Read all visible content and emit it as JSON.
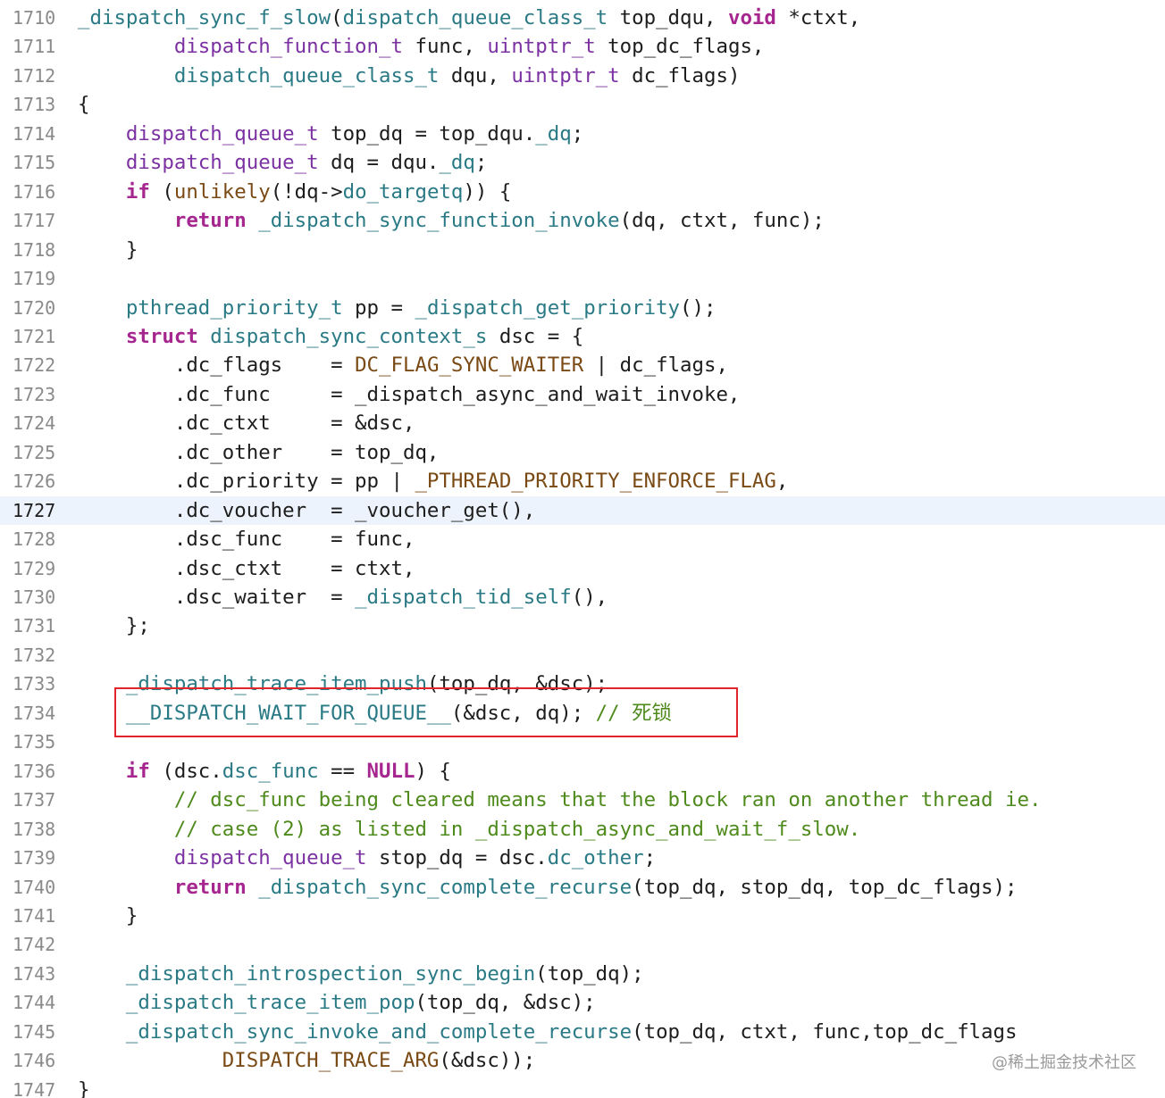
{
  "editor": {
    "current_line": "1727",
    "highlight_line": "1734",
    "watermark": "@稀土掘金技术社区",
    "lines": [
      {
        "num": "1710",
        "tokens": [
          {
            "t": "_dispatch_sync_f_slow",
            "c": "func"
          },
          {
            "t": "(",
            "c": "plain"
          },
          {
            "t": "dispatch_queue_class_t",
            "c": "func"
          },
          {
            "t": " top_dqu, ",
            "c": "plain"
          },
          {
            "t": "void",
            "c": "kw"
          },
          {
            "t": " *ctxt,",
            "c": "plain"
          }
        ]
      },
      {
        "num": "1711",
        "tokens": [
          {
            "t": "        ",
            "c": "plain"
          },
          {
            "t": "dispatch_function_t",
            "c": "type"
          },
          {
            "t": " func, ",
            "c": "plain"
          },
          {
            "t": "uintptr_t",
            "c": "type"
          },
          {
            "t": " top_dc_flags,",
            "c": "plain"
          }
        ]
      },
      {
        "num": "1712",
        "tokens": [
          {
            "t": "        ",
            "c": "plain"
          },
          {
            "t": "dispatch_queue_class_t",
            "c": "func"
          },
          {
            "t": " dqu, ",
            "c": "plain"
          },
          {
            "t": "uintptr_t",
            "c": "type"
          },
          {
            "t": " dc_flags)",
            "c": "plain"
          }
        ]
      },
      {
        "num": "1713",
        "tokens": [
          {
            "t": "{",
            "c": "plain"
          }
        ]
      },
      {
        "num": "1714",
        "tokens": [
          {
            "t": "    ",
            "c": "plain"
          },
          {
            "t": "dispatch_queue_t",
            "c": "type"
          },
          {
            "t": " top_dq = top_dqu.",
            "c": "plain"
          },
          {
            "t": "_dq",
            "c": "field"
          },
          {
            "t": ";",
            "c": "plain"
          }
        ]
      },
      {
        "num": "1715",
        "tokens": [
          {
            "t": "    ",
            "c": "plain"
          },
          {
            "t": "dispatch_queue_t",
            "c": "type"
          },
          {
            "t": " dq = dqu.",
            "c": "plain"
          },
          {
            "t": "_dq",
            "c": "field"
          },
          {
            "t": ";",
            "c": "plain"
          }
        ]
      },
      {
        "num": "1716",
        "tokens": [
          {
            "t": "    ",
            "c": "plain"
          },
          {
            "t": "if",
            "c": "kw"
          },
          {
            "t": " (",
            "c": "plain"
          },
          {
            "t": "unlikely",
            "c": "macro"
          },
          {
            "t": "(!dq->",
            "c": "plain"
          },
          {
            "t": "do_targetq",
            "c": "field"
          },
          {
            "t": ")) {",
            "c": "plain"
          }
        ]
      },
      {
        "num": "1717",
        "tokens": [
          {
            "t": "        ",
            "c": "plain"
          },
          {
            "t": "return",
            "c": "kw"
          },
          {
            "t": " ",
            "c": "plain"
          },
          {
            "t": "_dispatch_sync_function_invoke",
            "c": "func"
          },
          {
            "t": "(dq, ctxt, func);",
            "c": "plain"
          }
        ]
      },
      {
        "num": "1718",
        "tokens": [
          {
            "t": "    }",
            "c": "plain"
          }
        ]
      },
      {
        "num": "1719",
        "tokens": []
      },
      {
        "num": "1720",
        "tokens": [
          {
            "t": "    ",
            "c": "plain"
          },
          {
            "t": "pthread_priority_t",
            "c": "func"
          },
          {
            "t": " pp = ",
            "c": "plain"
          },
          {
            "t": "_dispatch_get_priority",
            "c": "func"
          },
          {
            "t": "();",
            "c": "plain"
          }
        ]
      },
      {
        "num": "1721",
        "tokens": [
          {
            "t": "    ",
            "c": "plain"
          },
          {
            "t": "struct",
            "c": "kw"
          },
          {
            "t": " ",
            "c": "plain"
          },
          {
            "t": "dispatch_sync_context_s",
            "c": "func"
          },
          {
            "t": " dsc = {",
            "c": "plain"
          }
        ]
      },
      {
        "num": "1722",
        "tokens": [
          {
            "t": "        .dc_flags    = ",
            "c": "plain"
          },
          {
            "t": "DC_FLAG_SYNC_WAITER",
            "c": "macro"
          },
          {
            "t": " | dc_flags,",
            "c": "plain"
          }
        ]
      },
      {
        "num": "1723",
        "tokens": [
          {
            "t": "        .dc_func     = _dispatch_async_and_wait_invoke,",
            "c": "plain"
          }
        ]
      },
      {
        "num": "1724",
        "tokens": [
          {
            "t": "        .dc_ctxt     = &dsc,",
            "c": "plain"
          }
        ]
      },
      {
        "num": "1725",
        "tokens": [
          {
            "t": "        .dc_other    = top_dq,",
            "c": "plain"
          }
        ]
      },
      {
        "num": "1726",
        "tokens": [
          {
            "t": "        .dc_priority = pp | ",
            "c": "plain"
          },
          {
            "t": "_PTHREAD_PRIORITY_ENFORCE_FLAG",
            "c": "macro"
          },
          {
            "t": ",",
            "c": "plain"
          }
        ]
      },
      {
        "num": "1727",
        "tokens": [
          {
            "t": "        .dc_voucher  = _voucher_get(),",
            "c": "plain"
          }
        ]
      },
      {
        "num": "1728",
        "tokens": [
          {
            "t": "        .dsc_func    = func,",
            "c": "plain"
          }
        ]
      },
      {
        "num": "1729",
        "tokens": [
          {
            "t": "        .dsc_ctxt    = ctxt,",
            "c": "plain"
          }
        ]
      },
      {
        "num": "1730",
        "tokens": [
          {
            "t": "        .dsc_waiter  = ",
            "c": "plain"
          },
          {
            "t": "_dispatch_tid_self",
            "c": "func"
          },
          {
            "t": "(),",
            "c": "plain"
          }
        ]
      },
      {
        "num": "1731",
        "tokens": [
          {
            "t": "    };",
            "c": "plain"
          }
        ]
      },
      {
        "num": "1732",
        "tokens": []
      },
      {
        "num": "1733",
        "tokens": [
          {
            "t": "    ",
            "c": "plain"
          },
          {
            "t": "_dispatch_trace_item_push",
            "c": "func"
          },
          {
            "t": "(top_dq, &dsc);",
            "c": "plain"
          }
        ]
      },
      {
        "num": "1734",
        "tokens": [
          {
            "t": "    ",
            "c": "plain"
          },
          {
            "t": "__DISPATCH_WAIT_FOR_QUEUE__",
            "c": "func"
          },
          {
            "t": "(&dsc, dq); ",
            "c": "plain"
          },
          {
            "t": "// 死锁",
            "c": "comment"
          }
        ]
      },
      {
        "num": "1735",
        "tokens": []
      },
      {
        "num": "1736",
        "tokens": [
          {
            "t": "    ",
            "c": "plain"
          },
          {
            "t": "if",
            "c": "kw"
          },
          {
            "t": " (dsc.",
            "c": "plain"
          },
          {
            "t": "dsc_func",
            "c": "field"
          },
          {
            "t": " == ",
            "c": "plain"
          },
          {
            "t": "NULL",
            "c": "kw"
          },
          {
            "t": ") {",
            "c": "plain"
          }
        ]
      },
      {
        "num": "1737",
        "tokens": [
          {
            "t": "        ",
            "c": "plain"
          },
          {
            "t": "// dsc_func being cleared means that the block ran on another thread ie.",
            "c": "comment"
          }
        ]
      },
      {
        "num": "1738",
        "tokens": [
          {
            "t": "        ",
            "c": "plain"
          },
          {
            "t": "// case (2) as listed in _dispatch_async_and_wait_f_slow.",
            "c": "comment"
          }
        ]
      },
      {
        "num": "1739",
        "tokens": [
          {
            "t": "        ",
            "c": "plain"
          },
          {
            "t": "dispatch_queue_t",
            "c": "type"
          },
          {
            "t": " stop_dq = dsc.",
            "c": "plain"
          },
          {
            "t": "dc_other",
            "c": "field"
          },
          {
            "t": ";",
            "c": "plain"
          }
        ]
      },
      {
        "num": "1740",
        "tokens": [
          {
            "t": "        ",
            "c": "plain"
          },
          {
            "t": "return",
            "c": "kw"
          },
          {
            "t": " ",
            "c": "plain"
          },
          {
            "t": "_dispatch_sync_complete_recurse",
            "c": "func"
          },
          {
            "t": "(top_dq, stop_dq, top_dc_flags);",
            "c": "plain"
          }
        ]
      },
      {
        "num": "1741",
        "tokens": [
          {
            "t": "    }",
            "c": "plain"
          }
        ]
      },
      {
        "num": "1742",
        "tokens": []
      },
      {
        "num": "1743",
        "tokens": [
          {
            "t": "    ",
            "c": "plain"
          },
          {
            "t": "_dispatch_introspection_sync_begin",
            "c": "func"
          },
          {
            "t": "(top_dq);",
            "c": "plain"
          }
        ]
      },
      {
        "num": "1744",
        "tokens": [
          {
            "t": "    ",
            "c": "plain"
          },
          {
            "t": "_dispatch_trace_item_pop",
            "c": "func"
          },
          {
            "t": "(top_dq, &dsc);",
            "c": "plain"
          }
        ]
      },
      {
        "num": "1745",
        "tokens": [
          {
            "t": "    ",
            "c": "plain"
          },
          {
            "t": "_dispatch_sync_invoke_and_complete_recurse",
            "c": "func"
          },
          {
            "t": "(top_dq, ctxt, func,top_dc_flags",
            "c": "plain"
          }
        ]
      },
      {
        "num": "1746",
        "tokens": [
          {
            "t": "            ",
            "c": "plain"
          },
          {
            "t": "DISPATCH_TRACE_ARG",
            "c": "macro"
          },
          {
            "t": "(&dsc));",
            "c": "plain"
          }
        ]
      },
      {
        "num": "1747",
        "tokens": [
          {
            "t": "}",
            "c": "plain"
          }
        ]
      }
    ]
  }
}
